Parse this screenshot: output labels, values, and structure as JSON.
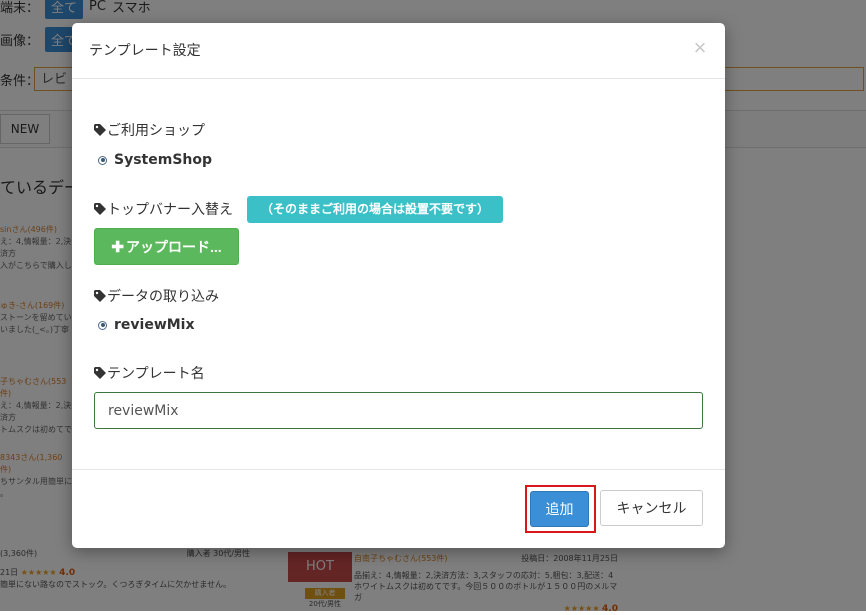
{
  "background": {
    "device_label": "端末：",
    "device_options": [
      "全て",
      "PC",
      "スマホ"
    ],
    "image_label": "画像：",
    "image_option": "全て",
    "condition_label": "条件：",
    "condition_value": "レビ",
    "new_tab": "NEW",
    "heading": "ているデー",
    "reviews": [
      {
        "user": "sinさん(496件)",
        "lines": [
          "え：4,情報量：2,決済方",
          "入がこちらで購入し"
        ]
      },
      {
        "user": "ゅき-さん(169件)",
        "lines": [
          "ストーンを留めてい",
          "いました(_<。)丁寧"
        ]
      },
      {
        "user": "子ちゃむさん(553件)",
        "lines": [
          "え：4,情報量：2,決済方",
          "トムスクは初めてで"
        ]
      },
      {
        "user": "8343さん(1,360件)",
        "lines": [
          "ちサンタル用簡単に",
          "。"
        ]
      }
    ],
    "bottom_left": {
      "count": "(3,360件)",
      "buyer": "購入者 30代/男性",
      "date": "21日",
      "score": "4.0",
      "text": "簡単にない路なのでストック。くつろぎタイムに欠かせません。"
    },
    "hot_label": "HOT",
    "bottom_right": {
      "user": "自南子ちゃむさん(553件)",
      "date": "投稿日：2008年11月25日",
      "line1": "品揃え：4,情報量：2,決済方法：3,スタッフの応対：5,梱包：3,配送：4",
      "line2": "ホワイトムスクは初めてです。今回５００のボトルが１５００円のメルマガ",
      "buyer_badge": "購入者",
      "age": "20代/男性",
      "score": "4.0"
    }
  },
  "modal": {
    "title": "テンプレート設定",
    "close_glyph": "×",
    "shop_section_label": "ご利用ショップ",
    "shop_option": "SystemShop",
    "banner_section_label": "トップバナー入替え",
    "banner_note": "（そのままご利用の場合は設置不要です）",
    "upload_label": "アップロード...",
    "upload_plus": "✚",
    "import_section_label": "データの取り込み",
    "import_option": "reviewMix",
    "template_name_label": "テンプレート名",
    "template_name_value": "reviewMix",
    "add_label": "追加",
    "cancel_label": "キャンセル"
  },
  "colors": {
    "primary": "#3a8fd6",
    "success": "#5cb85c",
    "info": "#3cc0c8",
    "highlight": "#d9171b",
    "input_border": "#3c763d"
  }
}
